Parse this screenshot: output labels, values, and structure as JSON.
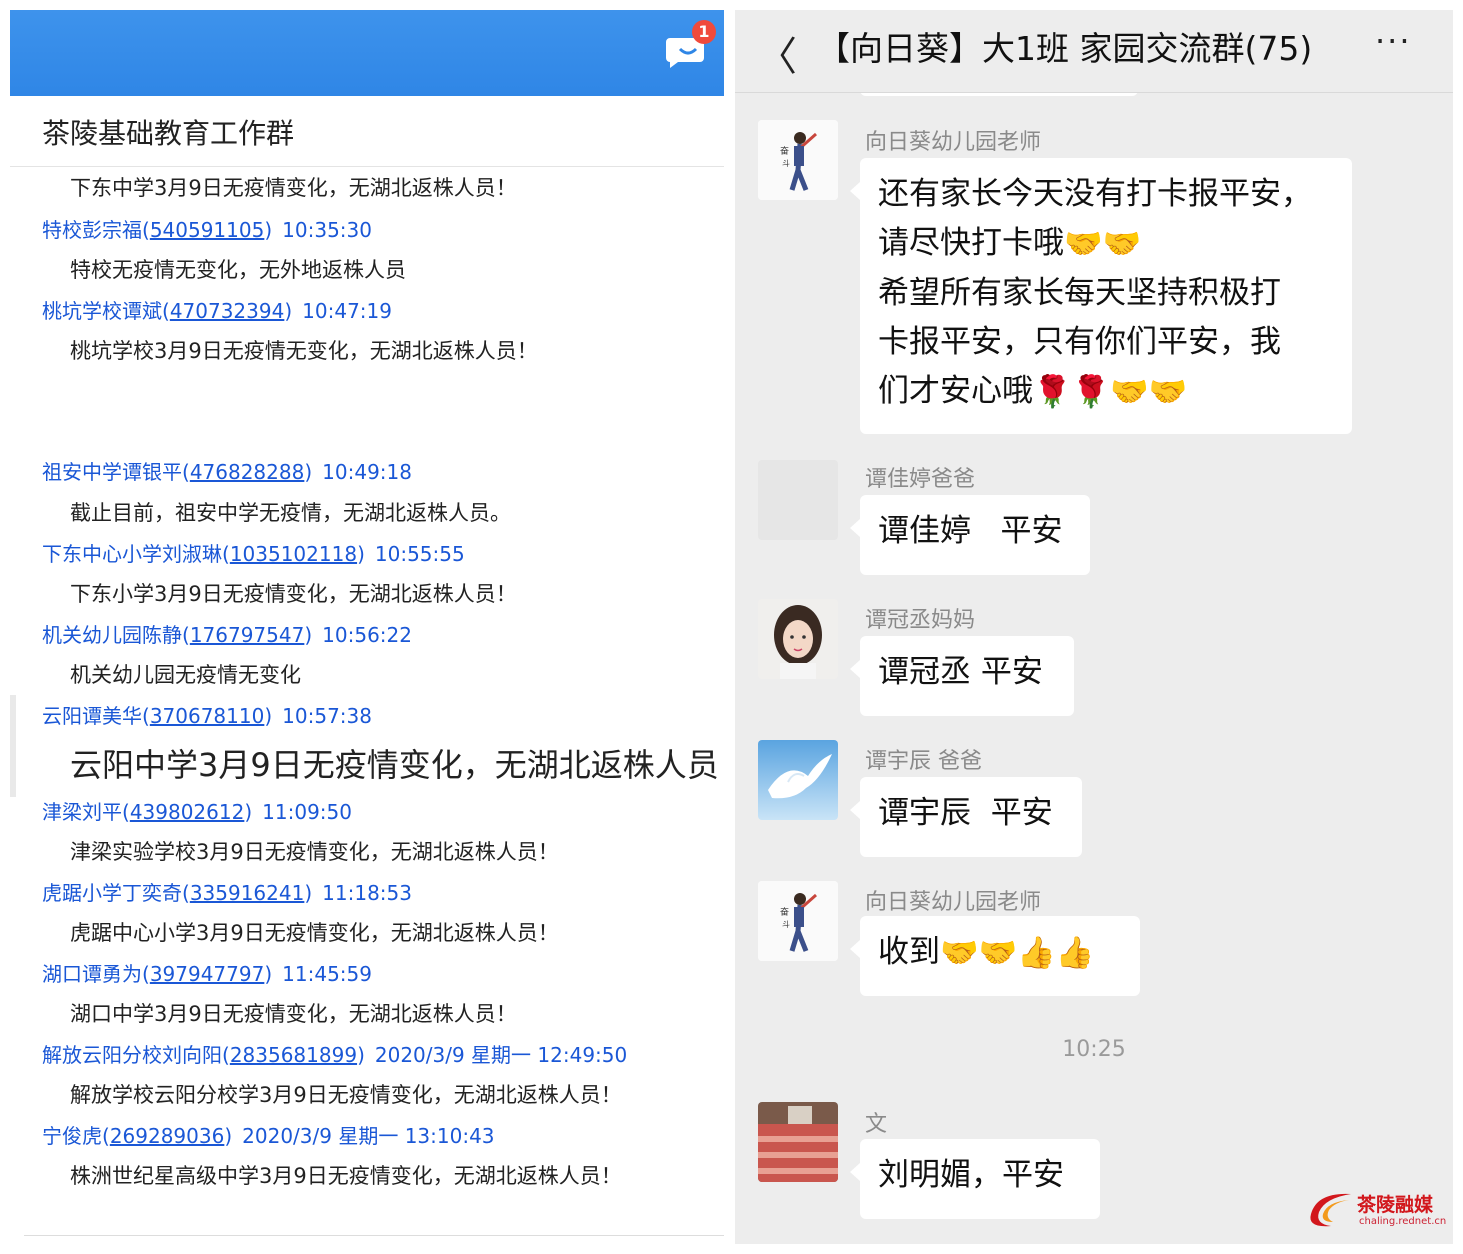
{
  "left_panel": {
    "badge_count": "1",
    "group_title": "茶陵基础教育工作群",
    "messages": [
      {
        "content": "下东中学3月9日无疫情变化，无湖北返株人员！"
      },
      {
        "name": "特校彭宗福",
        "qq": "540591105",
        "time": "10:35:30",
        "content": "特校无疫情无变化，无外地返株人员"
      },
      {
        "name": "桃坑学校谭斌",
        "qq": "470732394",
        "time": "10:47:19",
        "content": "桃坑学校3月9日无疫情无变化，无湖北返株人员！"
      },
      {
        "name": "祖安中学谭银平",
        "qq": "476828288",
        "time": "10:49:18",
        "content": "截止目前，祖安中学无疫情，无湖北返株人员。"
      },
      {
        "name": "下东中心小学刘淑琳",
        "qq": "1035102118",
        "time": "10:55:55",
        "content": "下东小学3月9日无疫情变化，无湖北返株人员！"
      },
      {
        "name": "机关幼儿园陈静",
        "qq": "176797547",
        "time": "10:56:22",
        "content": "机关幼儿园无疫情无变化"
      },
      {
        "name": "云阳谭美华",
        "qq": "370678110",
        "time": "10:57:38",
        "content": "云阳中学3月9日无疫情变化，无湖北返株人员！"
      },
      {
        "name": "津梁刘平",
        "qq": "439802612",
        "time": "11:09:50",
        "content": "津梁实验学校3月9日无疫情变化，无湖北返株人员！"
      },
      {
        "name": "虎踞小学丁奕奇",
        "qq": "335916241",
        "time": "11:18:53",
        "content": "虎踞中心小学3月9日无疫情变化，无湖北返株人员！"
      },
      {
        "name": "湖口谭勇为",
        "qq": "397947797",
        "time": "11:45:59",
        "content": "湖口中学3月9日无疫情变化，无湖北返株人员！"
      },
      {
        "name": "解放云阳分校刘向阳",
        "qq": "2835681899",
        "time": "2020/3/9 星期一 12:49:50",
        "content": "解放学校云阳分校学3月9日无疫情变化，无湖北返株人员！"
      },
      {
        "name": "宁俊虎",
        "qq": "269289036",
        "time": "2020/3/9 星期一 13:10:43",
        "content": "株洲世纪星高级中学3月9日无疫情变化，无湖北返株人员！"
      }
    ]
  },
  "right_panel": {
    "chat_title": "【向日葵】大1班 家园交流群(75)",
    "back_glyph": "〈",
    "more_glyph": "···",
    "messages": [
      {
        "nick": "向日葵幼儿园老师",
        "lines": [
          "还有家长今天没有打卡报平安，",
          "请尽快打卡哦",
          "希望所有家长每天坚持积极打",
          "卡报平安，只有你们平安，我",
          "们才安心哦"
        ]
      },
      {
        "nick": "谭佳婷爸爸",
        "text": "谭佳婷   平安"
      },
      {
        "nick": "谭冠丞妈妈",
        "text": "谭冠丞 平安"
      },
      {
        "nick": "谭宇辰  爸爸",
        "text": "谭宇辰  平安"
      },
      {
        "nick": "向日葵幼儿园老师",
        "text": "收到"
      },
      {
        "time": "10:25"
      },
      {
        "nick": "文",
        "text": "刘明媚，平安"
      }
    ]
  },
  "watermark": {
    "title": "茶陵融媒",
    "subtitle": "chaling.rednet.cn"
  }
}
